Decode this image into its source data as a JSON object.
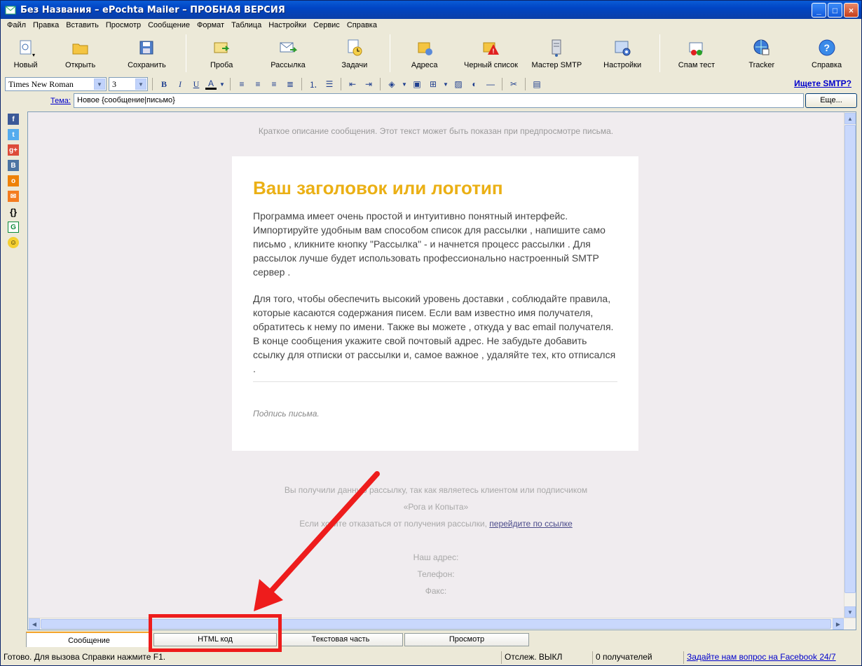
{
  "window": {
    "title": "Без Названия – ePochta Mailer – ПРОБНАЯ ВЕРСИЯ",
    "buttons": [
      "_",
      "□",
      "×"
    ]
  },
  "menu": [
    "Файл",
    "Правка",
    "Вставить",
    "Просмотр",
    "Сообщение",
    "Формат",
    "Таблица",
    "Настройки",
    "Сервис",
    "Справка"
  ],
  "toolbar": {
    "new": "Новый",
    "open": "Открыть",
    "save": "Сохранить",
    "test": "Проба",
    "send": "Рассылка",
    "tasks": "Задачи",
    "addresses": "Адреса",
    "blacklist": "Черный список",
    "smtp_wizard": "Мастер SMTP",
    "settings": "Настройки",
    "spam_test": "Спам тест",
    "tracker": "Tracker",
    "help": "Справка"
  },
  "format": {
    "font": "Times New Roman",
    "size": "3",
    "smtp_link": "Ищете SMTP?"
  },
  "subject": {
    "label": "Тема:",
    "value": "Новое {сообщение|письмо}",
    "more_button": "Еще..."
  },
  "message": {
    "preheader": "Краткое описание сообщения. Этот текст может быть показан при предпросмотре письма.",
    "heading": "Ваш заголовок или логотип",
    "paragraph1": "Программа имеет очень простой и интуитивно понятный интерфейс. Импортируйте удобным вам способом список для рассылки , напишите само письмо , кликните кнопку \"Рассылка\" - и начнется процесс рассылки . Для рассылок лучше будет использовать профессионально настроенный SMTP сервер .",
    "paragraph2": "Для того, чтобы обеспечить высокий уровень доставки , соблюдайте правила, которые касаются содержания писем. Если вам известно имя получателя, обратитесь к нему по имени. Также вы можете , откуда у вас email получателя. В конце сообщения укажите свой почтовый адрес. Не забудьте добавить ссылку для отписки от рассылки и, самое важное , удаляйте тех, кто отписался .",
    "signature": "Подпись письма.",
    "footer_line1": "Вы получили данную рассылку, так как являетесь клиентом или подписчиком",
    "footer_line2": "«Рога и Копыта»",
    "footer_line3_text": "Если хотите отказаться от получения рассылки,",
    "footer_line3_link": "перейдите по ссылке",
    "footer_address": "Наш адрес:",
    "footer_phone": "Телефон:",
    "footer_fax": "Факс:"
  },
  "tabs": [
    "Сообщение",
    "HTML код",
    "Текстовая часть",
    "Просмотр"
  ],
  "status": {
    "ready": "Готово. Для вызова Справки нажмите F1.",
    "tracking": "Отслеж. ВЫКЛ",
    "recipients": "0 получателей",
    "facebook": "Задайте нам вопрос на Facebook 24/7"
  },
  "colors": {
    "heading": "#ebb015",
    "annotation": "#ee1c1c"
  }
}
